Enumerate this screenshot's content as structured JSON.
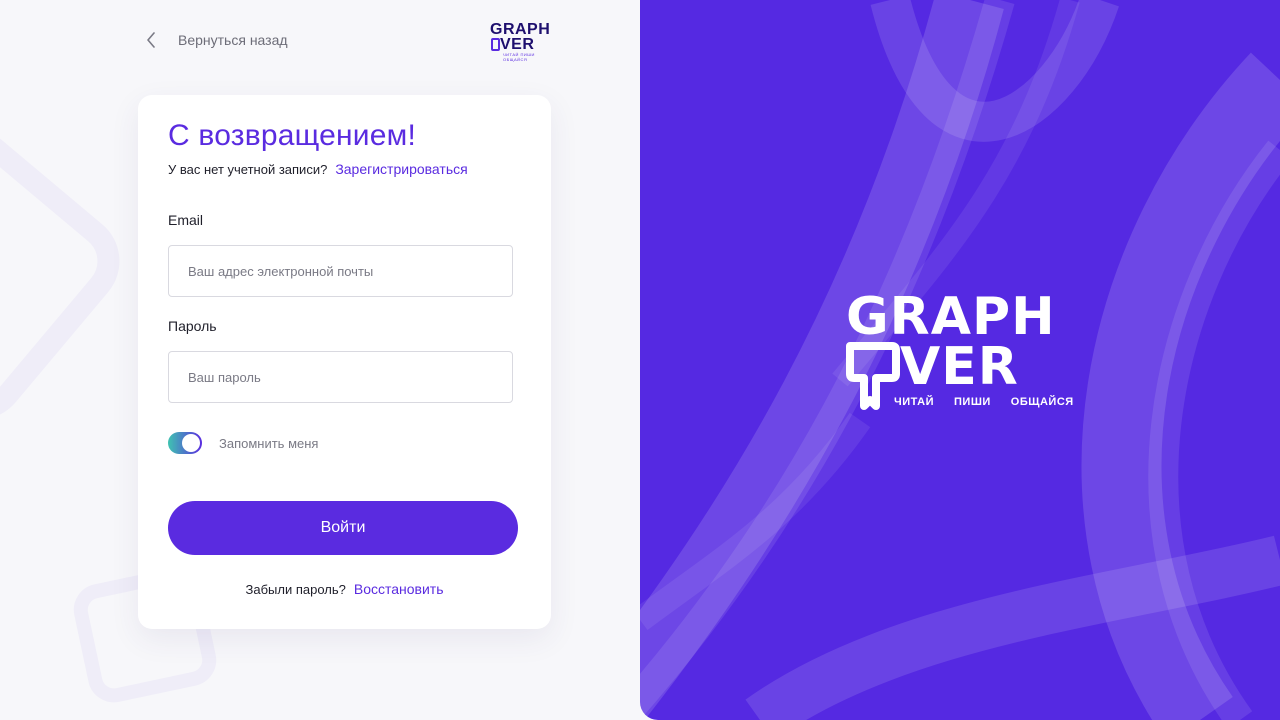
{
  "nav": {
    "back_label": "Вернуться назад"
  },
  "brand": {
    "line1": "GRAPH",
    "line2": "VER",
    "tagline": [
      "ЧИТАЙ",
      "ПИШИ",
      "ОБЩАЙСЯ"
    ],
    "primary_color": "#5a2be0",
    "panel_color": "#5529e2"
  },
  "form": {
    "title": "С возвращением!",
    "no_account_text": "У вас нет учетной записи?",
    "register_link": "Зарегистрироваться",
    "email_label": "Email",
    "email_placeholder": "Ваш адрес электронной почты",
    "email_value": "",
    "password_label": "Пароль",
    "password_placeholder": "Ваш пароль",
    "password_value": "",
    "remember_label": "Запомнить меня",
    "remember_checked": true,
    "submit_label": "Войти",
    "forgot_text": "Забыли пароль?",
    "restore_link": "Восстановить"
  },
  "icons": {
    "back": "chevron-left-icon"
  }
}
